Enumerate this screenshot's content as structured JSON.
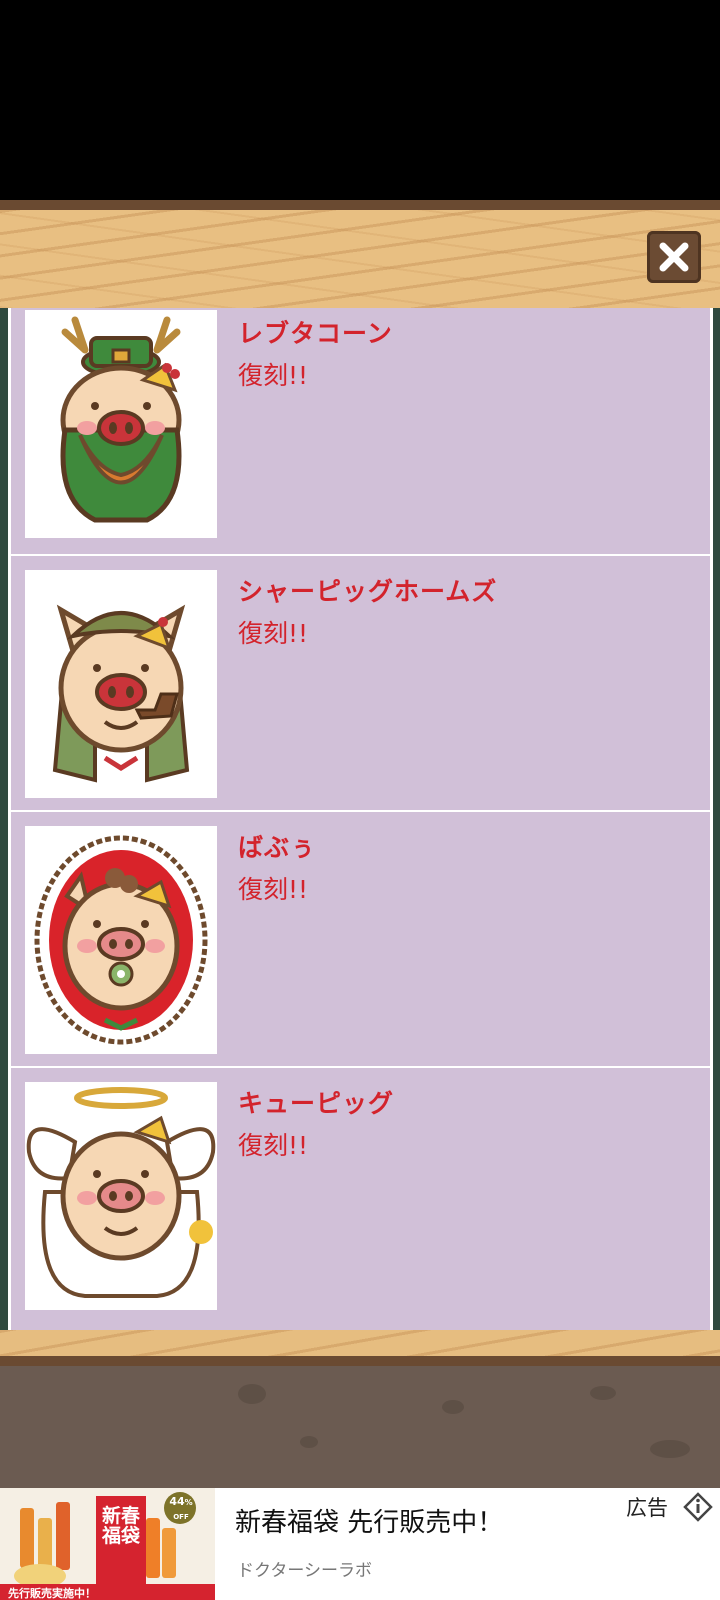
{
  "header": {
    "close_icon": "close-x-icon"
  },
  "items": [
    {
      "title": "レブタコーン",
      "status": "復刻!!"
    },
    {
      "title": "シャーピッグホームズ",
      "status": "復刻!!"
    },
    {
      "title": "ばぶぅ",
      "status": "復刻!!"
    },
    {
      "title": "キューピッグ",
      "status": "復刻!!"
    }
  ],
  "ad": {
    "title": "新春福袋 先行販売中！",
    "advertiser": "ドクターシーラボ",
    "label": "広告",
    "image_text": {
      "main": "新春福袋",
      "discount_pct": "44",
      "discount_unit": "%",
      "discount_off": "OFF",
      "banner": "先行販売実施中！"
    }
  },
  "colors": {
    "row_bg": "#d1c0d8",
    "title_red": "#d3232c",
    "wood": "#e8bf82",
    "wood_dark": "#6a4a31"
  }
}
